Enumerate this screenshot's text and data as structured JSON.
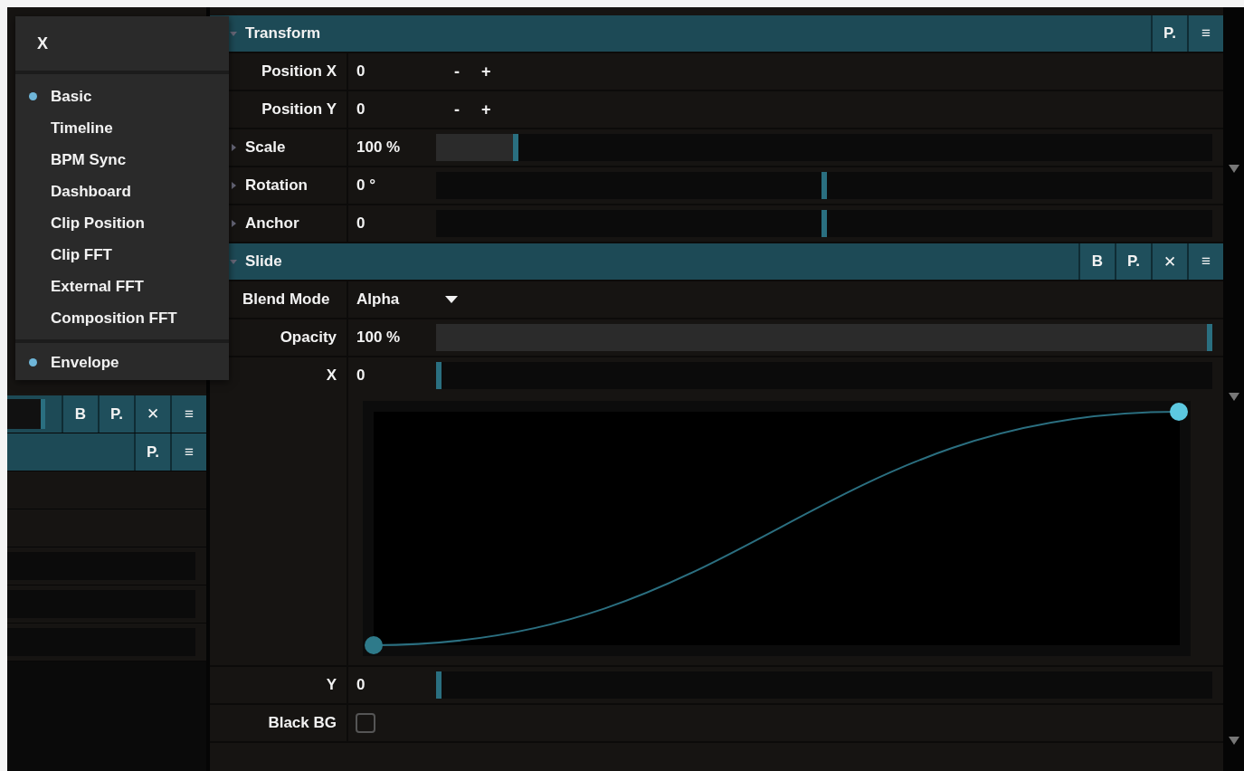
{
  "menu": {
    "title": "X",
    "groups": [
      {
        "items": [
          {
            "label": "Basic",
            "selected": true
          },
          {
            "label": "Timeline",
            "selected": false
          },
          {
            "label": "BPM Sync",
            "selected": false
          },
          {
            "label": "Dashboard",
            "selected": false
          },
          {
            "label": "Clip Position",
            "selected": false
          },
          {
            "label": "Clip FFT",
            "selected": false
          },
          {
            "label": "External FFT",
            "selected": false
          },
          {
            "label": "Composition FFT",
            "selected": false
          }
        ]
      },
      {
        "items": [
          {
            "label": "Envelope",
            "selected": true
          }
        ]
      }
    ]
  },
  "left_panel": {
    "rows": [
      {
        "kind": "slider_header",
        "buttons": [
          "B",
          "P.",
          "✕",
          "≡"
        ]
      },
      {
        "kind": "header",
        "buttons": [
          "P.",
          "≡"
        ]
      },
      {
        "kind": "blank"
      },
      {
        "kind": "blank"
      },
      {
        "kind": "track"
      },
      {
        "kind": "track"
      },
      {
        "kind": "track"
      }
    ]
  },
  "sections": [
    {
      "title": "Transform",
      "buttons": [
        "P.",
        "≡"
      ],
      "params": [
        {
          "kind": "stepper",
          "label": "Position X",
          "value": "0",
          "steps": [
            "-",
            "+"
          ]
        },
        {
          "kind": "stepper",
          "label": "Position Y",
          "value": "0",
          "steps": [
            "-",
            "+"
          ]
        },
        {
          "kind": "slider",
          "label": "Scale",
          "value": "100 %",
          "level": 0.1,
          "fill": true,
          "expandable": true
        },
        {
          "kind": "slider",
          "label": "Rotation",
          "value": "0 °",
          "level": 0.5,
          "fill": false,
          "expandable": true
        },
        {
          "kind": "slider",
          "label": "Anchor",
          "value": "0",
          "level": 0.5,
          "fill": false,
          "expandable": true
        }
      ]
    },
    {
      "title": "Slide",
      "buttons": [
        "B",
        "P.",
        "✕",
        "≡"
      ],
      "params": [
        {
          "kind": "dropdown",
          "label": "Blend Mode",
          "value": "Alpha"
        },
        {
          "kind": "slider",
          "label": "Opacity",
          "value": "100 %",
          "level": 1,
          "fill": true
        },
        {
          "kind": "slider",
          "label": "X",
          "value": "0",
          "level": 0,
          "envelope": true
        },
        {
          "kind": "slider",
          "label": "Y",
          "value": "0",
          "level": 0
        },
        {
          "kind": "checkbox",
          "label": "Black BG",
          "checked": false
        }
      ]
    }
  ]
}
